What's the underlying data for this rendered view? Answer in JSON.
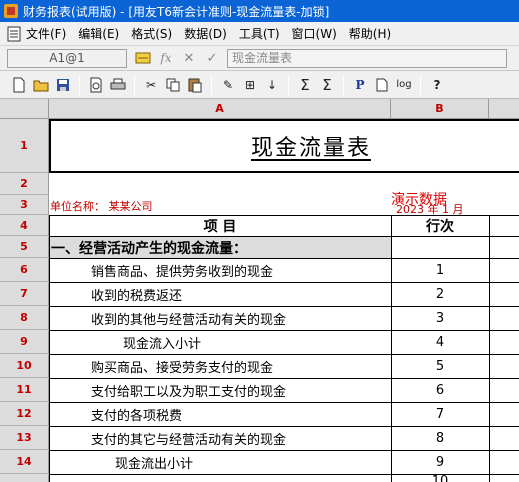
{
  "window": {
    "title": "财务报表(试用版) - [用友T6新会计准则-现金流量表-加锁]"
  },
  "menu": {
    "items": [
      "文件(F)",
      "编辑(E)",
      "格式(S)",
      "数据(D)",
      "工具(T)",
      "窗口(W)",
      "帮助(H)"
    ]
  },
  "formula_bar": {
    "cell_ref": "A1@1",
    "content": "现金流量表"
  },
  "toolbar": {
    "sum_label": "Σ",
    "p_label": "P",
    "log_label": "log",
    "help_label": "?"
  },
  "sheet": {
    "col_headers": [
      "A",
      "B"
    ],
    "row_numbers": [
      "1",
      "2",
      "3",
      "4",
      "5",
      "6",
      "7",
      "8",
      "9",
      "10",
      "11",
      "12",
      "13",
      "14"
    ],
    "title": "现金流量表",
    "unit_label": "单位名称：  某某公司",
    "demo_text": "演示数据",
    "date_text": "2023 年  1  月",
    "header_item": "项          目",
    "header_seq": "行次",
    "section_1": "一、经营活动产生的现金流量：",
    "rows": [
      {
        "label": "销售商品、提供劳务收到的现金",
        "seq": "1"
      },
      {
        "label": "收到的税费返还",
        "seq": "2"
      },
      {
        "label": "收到的其他与经营活动有关的现金",
        "seq": "3"
      },
      {
        "label": "现金流入小计",
        "seq": "4"
      },
      {
        "label": "购买商品、接受劳务支付的现金",
        "seq": "5"
      },
      {
        "label": "支付给职工以及为职工支付的现金",
        "seq": "6"
      },
      {
        "label": "支付的各项税费",
        "seq": "7"
      },
      {
        "label": "支付的其它与经营活动有关的现金",
        "seq": "8"
      },
      {
        "label": "现金流出小计",
        "seq": "9"
      }
    ],
    "partial_row_seq": "10"
  },
  "colors": {
    "titlebar": "#0a64d6",
    "header_red": "#c00000",
    "section_bg": "#dcdcdc"
  }
}
